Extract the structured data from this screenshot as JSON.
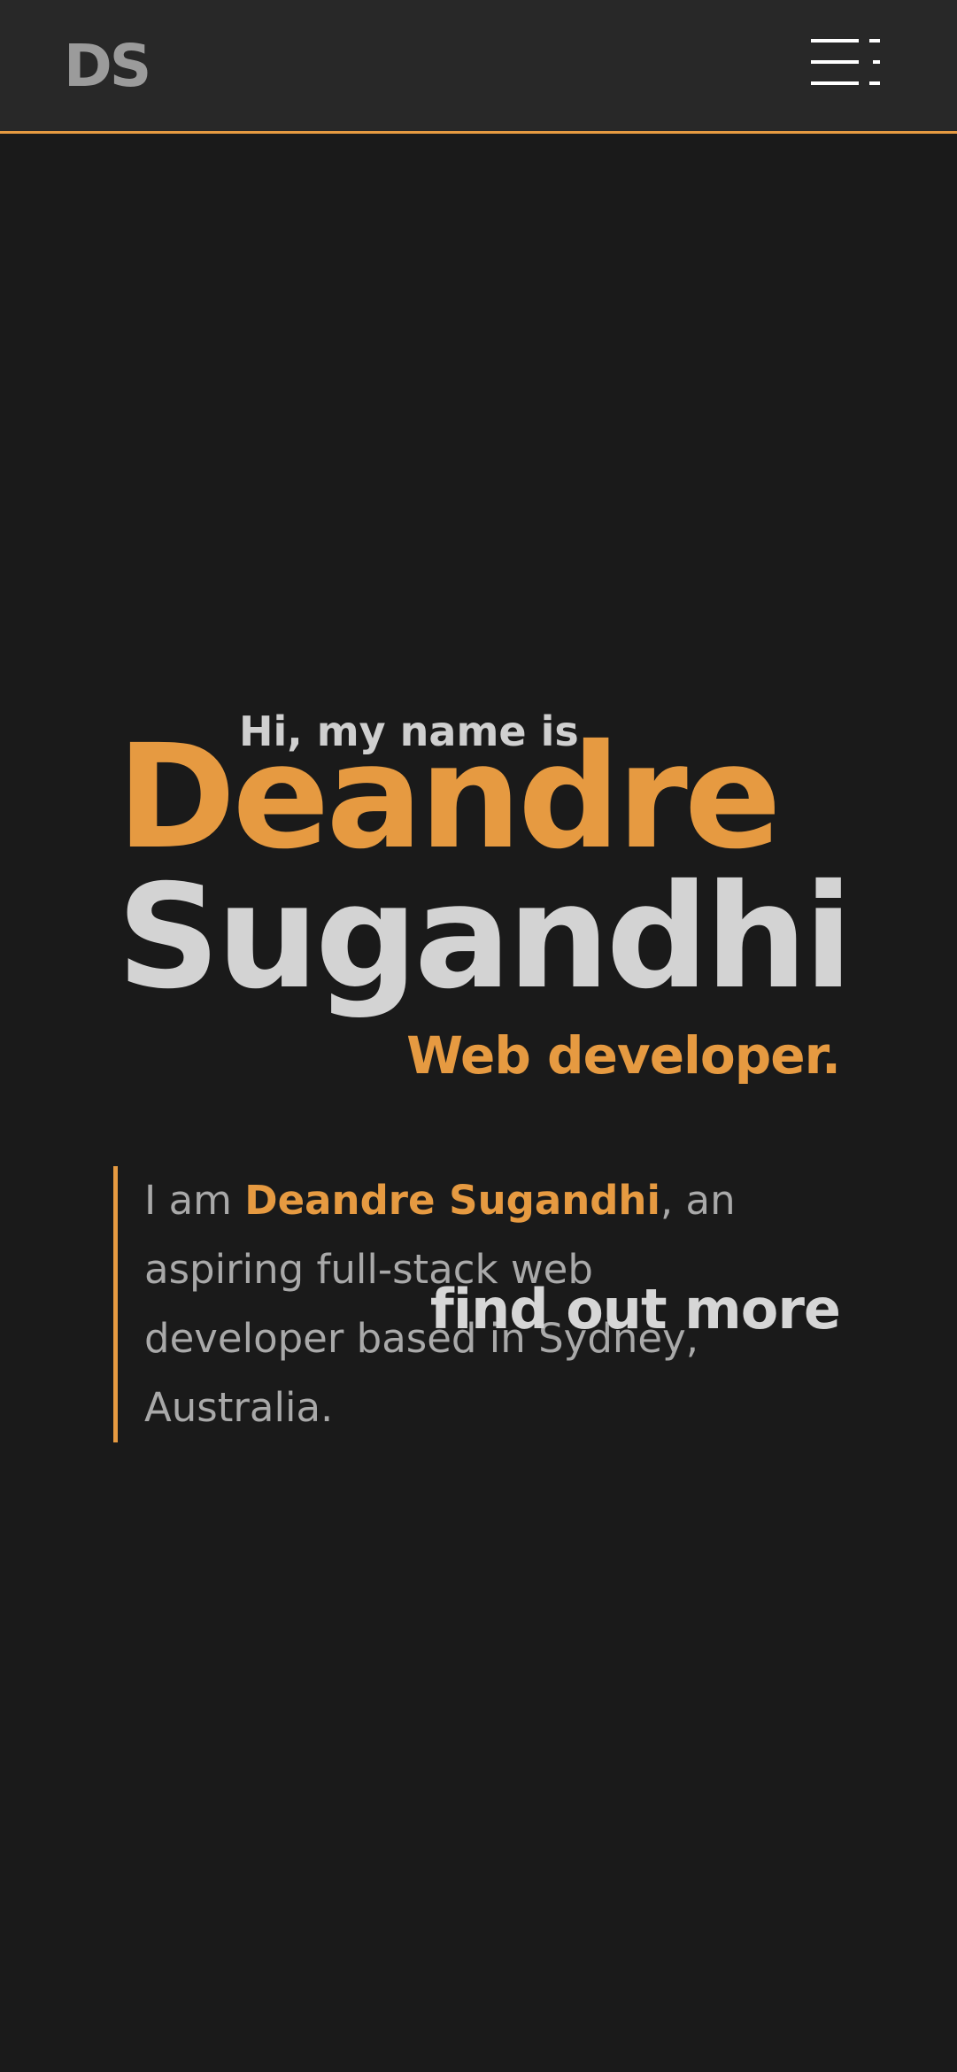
{
  "header": {
    "logo_text": "DS",
    "menu_icon": "menu-icon"
  },
  "hero": {
    "greeting": "Hi, my name is",
    "first_name": "Deandre",
    "last_name": "Sugandhi",
    "role": "Web developer.",
    "bio": {
      "prefix": "I am ",
      "highlight": "Deandre Sugandhi",
      "suffix": ", an aspiring full-stack web developer based in Sydney, Australia."
    },
    "cta_label": "find out more"
  },
  "colors": {
    "background": "#1a1a1a",
    "header_background": "#282828",
    "accent": "#e69a41",
    "text_light": "#d3d3d3",
    "text_muted": "#a9a9a9"
  }
}
